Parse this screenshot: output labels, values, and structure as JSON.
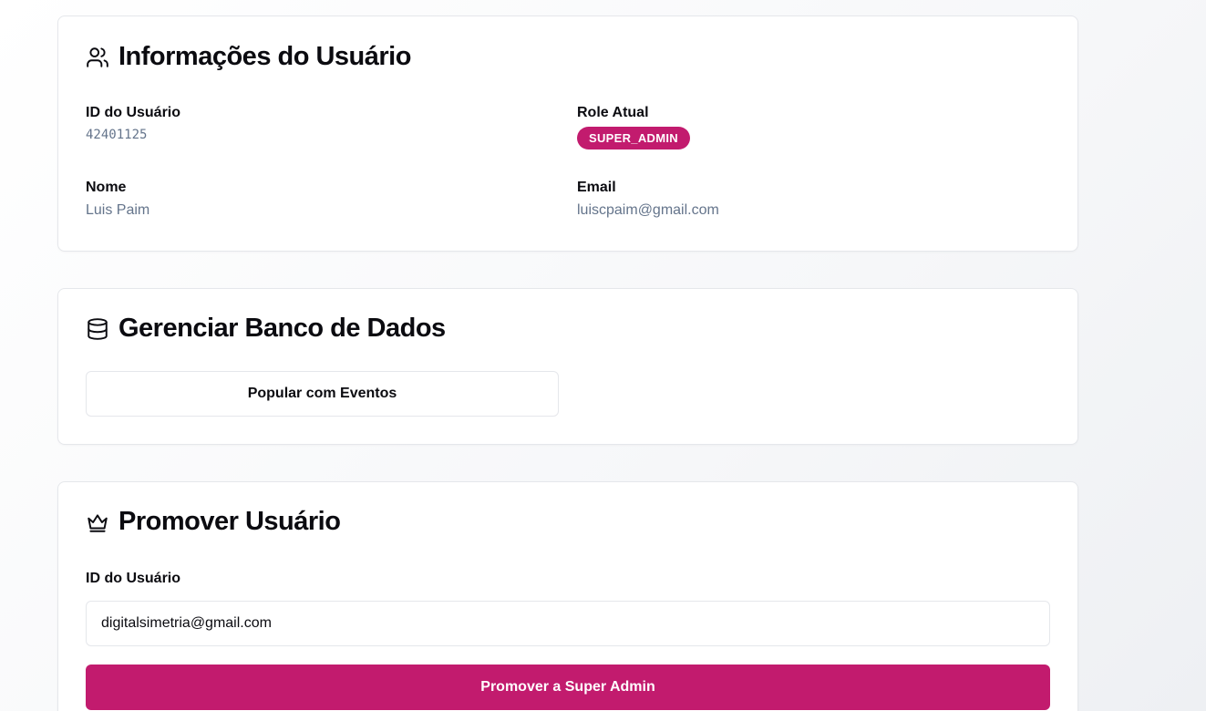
{
  "theme": {
    "accent": "#c21b6e",
    "muted_text": "#64748b",
    "border": "#e5e7eb"
  },
  "user_info": {
    "title": "Informações do Usuário",
    "icon": "users-icon",
    "id_label": "ID do Usuário",
    "id_value": "42401125",
    "role_label": "Role Atual",
    "role_value": "SUPER_ADMIN",
    "name_label": "Nome",
    "name_value": "Luis Paim",
    "email_label": "Email",
    "email_value": "luiscpaim@gmail.com"
  },
  "database": {
    "title": "Gerenciar Banco de Dados",
    "icon": "database-icon",
    "populate_button": "Popular com Eventos"
  },
  "promote": {
    "title": "Promover Usuário",
    "icon": "crown-icon",
    "id_label": "ID do Usuário",
    "id_input_value": "digitalsimetria@gmail.com",
    "submit_button": "Promover a Super Admin"
  }
}
